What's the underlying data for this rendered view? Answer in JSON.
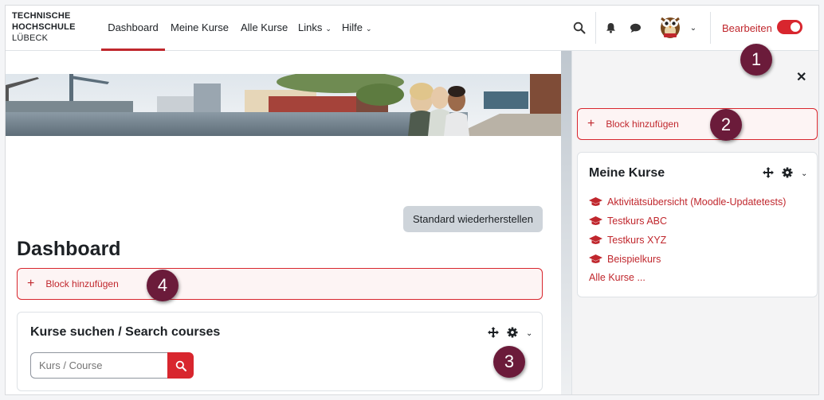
{
  "logo": {
    "line1": "TECHNISCHE",
    "line2": "HOCHSCHULE",
    "line3": "LÜBECK"
  },
  "nav": {
    "items": [
      {
        "label": "Dashboard"
      },
      {
        "label": "Meine Kurse"
      },
      {
        "label": "Alle Kurse"
      },
      {
        "label": "Links"
      },
      {
        "label": "Hilfe"
      }
    ],
    "edit_label": "Bearbeiten",
    "edit_mode": true
  },
  "main": {
    "reset_button": "Standard wiederherstellen",
    "title": "Dashboard",
    "add_block": "Block hinzufügen",
    "search_card": {
      "title": "Kurse suchen / Search courses",
      "placeholder": "Kurs / Course"
    }
  },
  "drawer": {
    "add_block": "Block hinzufügen",
    "courses_block": {
      "title": "Meine Kurse",
      "courses": [
        "Aktivitätsübersicht (Moodle-Updatetests)",
        "Testkurs ABC",
        "Testkurs XYZ",
        "Beispielkurs"
      ],
      "all_courses": "Alle Kurse ..."
    }
  },
  "callouts": [
    "1",
    "2",
    "3",
    "4"
  ],
  "colors": {
    "accent": "#c0272d",
    "callout": "#6b1b3a",
    "toggle": "#d8262e"
  },
  "icons": [
    "search-icon",
    "bell-icon",
    "chat-icon",
    "owl-avatar",
    "close-icon",
    "move-icon",
    "gear-icon",
    "chevron-down-icon",
    "graduation-cap-icon",
    "plus-icon"
  ]
}
